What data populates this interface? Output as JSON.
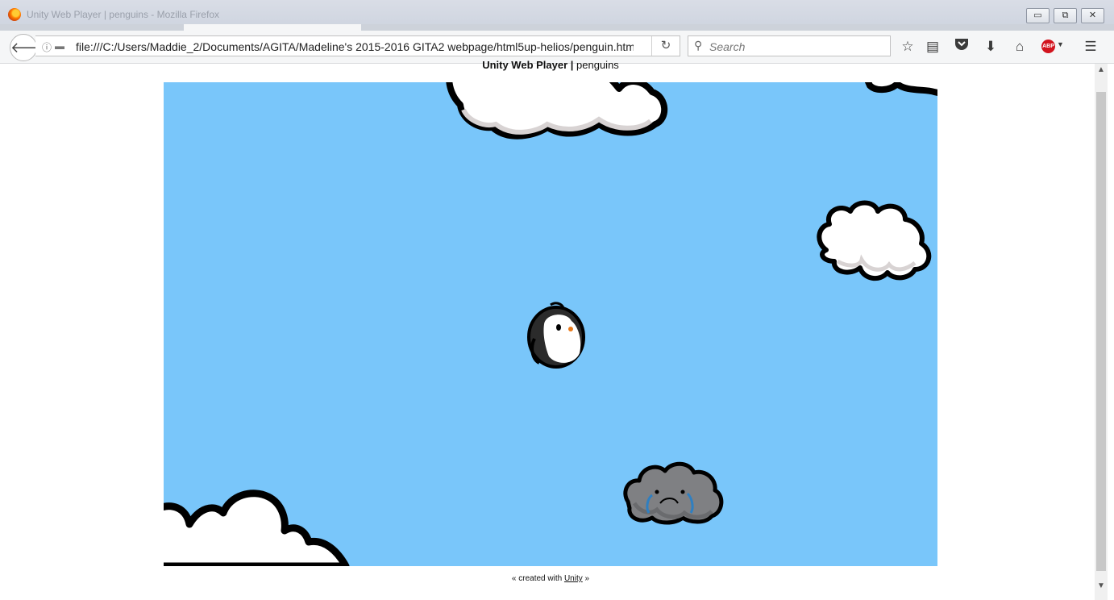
{
  "window": {
    "title": "Unity Web Player | penguins - Mozilla Firefox",
    "controls": {
      "minimize": "▭",
      "restore": "⧉",
      "close": "✕"
    }
  },
  "toolbar": {
    "url": "file:///C:/Users/Maddie_2/Documents/AGITA/Madeline's 2015-2016 GITA2 webpage/html5up-helios/penguin.htm",
    "search_placeholder": "Search",
    "icons": [
      "back-icon",
      "info-icon",
      "page-icon",
      "reload-icon",
      "search-icon",
      "bookmark-star-icon",
      "reading-list-icon",
      "pocket-icon",
      "download-icon",
      "home-icon",
      "adblock-plus-icon",
      "menu-icon"
    ],
    "abp_label": "ABP"
  },
  "page": {
    "heading_bold": "Unity Web Player |",
    "heading_rest": "penguins",
    "footer_prefix": "« created with",
    "footer_link": "Unity",
    "footer_suffix": "»"
  },
  "game": {
    "background_color": "#79c6fa",
    "sprites": [
      "cloud",
      "cloud",
      "cloud",
      "cloud",
      "penguin",
      "crying-storm-cloud"
    ]
  }
}
